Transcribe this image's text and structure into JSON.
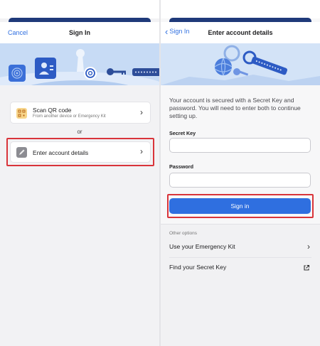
{
  "left_screen": {
    "cancel_label": "Cancel",
    "title": "Sign In",
    "options": [
      {
        "title": "Scan QR code",
        "subtitle": "From another device or Emergency Kit",
        "icon": "qr-code-icon"
      },
      {
        "title": "Enter account details",
        "subtitle": "",
        "icon": "pencil-icon"
      }
    ],
    "or_label": "or"
  },
  "right_screen": {
    "back_label": "Sign In",
    "title": "Enter account details",
    "intro": "Your account is secured with a Secret Key and password. You will need to enter both to continue setting up.",
    "secret_key_label": "Secret Key",
    "secret_key_value": "",
    "password_label": "Password",
    "password_value": "",
    "signin_label": "Sign in",
    "other_options_label": "Other options",
    "other_options": [
      {
        "label": "Use your Emergency Kit",
        "icon": "chevron-right-icon"
      },
      {
        "label": "Find your Secret Key",
        "icon": "external-link-icon"
      }
    ]
  },
  "colors": {
    "accent": "#2f6fe0",
    "highlight": "#d9343a",
    "hero_background": "#bcd3f2",
    "sheet_header": "#1f3a7a"
  }
}
